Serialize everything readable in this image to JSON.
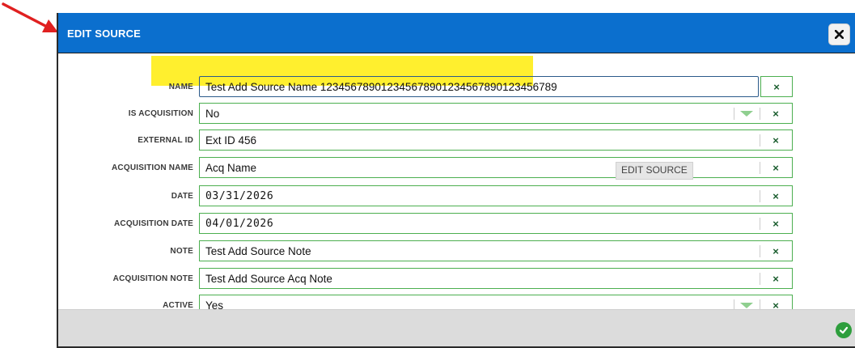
{
  "dialog": {
    "title": "EDIT SOURCE",
    "close_icon": "close-icon",
    "save_icon": "check-circle-icon"
  },
  "tooltip": "EDIT SOURCE",
  "fields": [
    {
      "label": "NAME",
      "value": "Test Add Source Name 123456789012345678901234567890123456789",
      "type": "text"
    },
    {
      "label": "IS ACQUISITION",
      "value": "No",
      "type": "select"
    },
    {
      "label": "EXTERNAL ID",
      "value": "Ext ID 456",
      "type": "text"
    },
    {
      "label": "ACQUISITION NAME",
      "value": "Acq Name",
      "type": "text"
    },
    {
      "label": "DATE",
      "value": "03/31/2026",
      "type": "date"
    },
    {
      "label": "ACQUISITION DATE",
      "value": "04/01/2026",
      "type": "date"
    },
    {
      "label": "NOTE",
      "value": "Test Add Source Note",
      "type": "text"
    },
    {
      "label": "ACQUISITION NOTE",
      "value": "Test Add Source Acq Note",
      "type": "text"
    },
    {
      "label": "ACTIVE",
      "value": "Yes",
      "type": "select"
    }
  ],
  "clear_glyph": "×",
  "colors": {
    "titlebar": "#0b6fce",
    "field_border": "#4caf50",
    "highlight": "#ffef2e",
    "ok": "#2e9e3d",
    "annotation_arrow": "#e02020"
  }
}
